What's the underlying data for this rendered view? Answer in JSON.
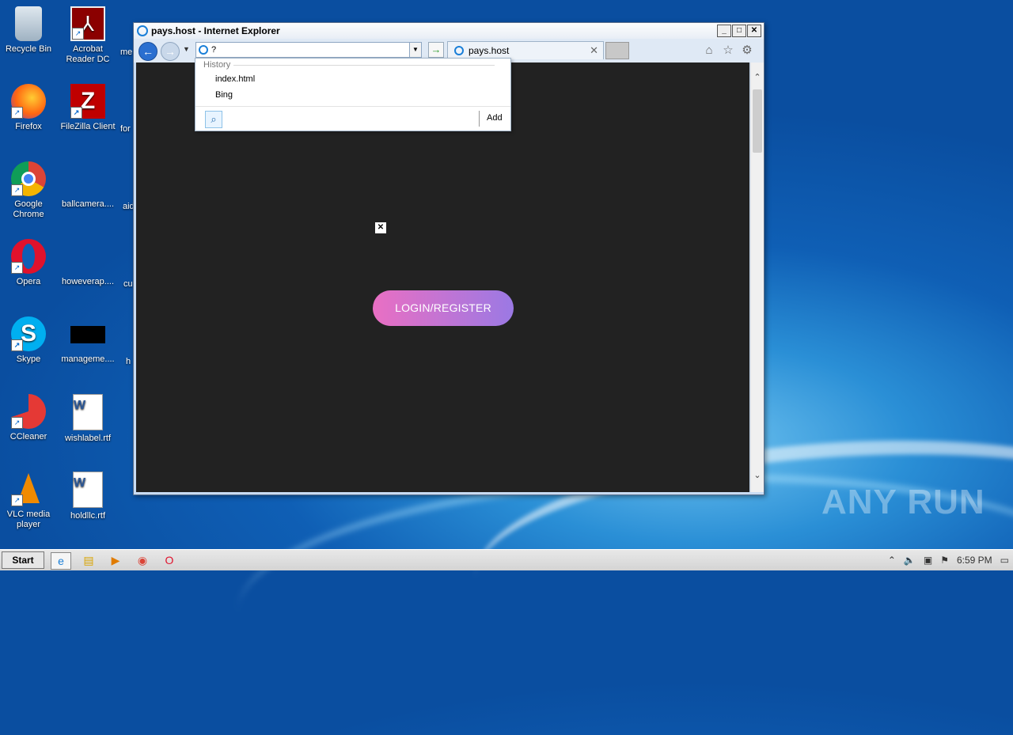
{
  "desktop": {
    "icons": [
      {
        "label": "Recycle Bin",
        "icon": "recycle-bin-icon"
      },
      {
        "label": "Acrobat Reader DC",
        "icon": "acrobat-icon"
      },
      {
        "label": "Firefox",
        "icon": "firefox-icon"
      },
      {
        "label": "FileZilla Client",
        "icon": "filezilla-icon"
      },
      {
        "label": "Google Chrome",
        "icon": "chrome-icon"
      },
      {
        "label": "ballcamera....",
        "icon": "blank-file-icon"
      },
      {
        "label": "Opera",
        "icon": "opera-icon"
      },
      {
        "label": "howeverap....",
        "icon": "blank-file-icon"
      },
      {
        "label": "Skype",
        "icon": "skype-icon"
      },
      {
        "label": "manageme....",
        "icon": "black-file-icon"
      },
      {
        "label": "CCleaner",
        "icon": "ccleaner-icon"
      },
      {
        "label": "wishlabel.rtf",
        "icon": "word-document-icon"
      },
      {
        "label": "VLC media player",
        "icon": "vlc-icon"
      },
      {
        "label": "holdllc.rtf",
        "icon": "word-document-icon"
      }
    ],
    "partial_labels": [
      "me",
      "for",
      "aid",
      "cu",
      "h"
    ]
  },
  "window": {
    "title": "pays.host - Internet Explorer",
    "address_value": "?",
    "tab_label": "pays.host",
    "minimize": "_",
    "maximize": "□",
    "close": "✕"
  },
  "dropdown": {
    "section_label": "History",
    "items": [
      "index.html",
      "Bing"
    ],
    "add_label": "Add"
  },
  "page": {
    "button_label": "LOGIN/REGISTER",
    "broken_image_glyph": "✕"
  },
  "taskbar": {
    "start_label": "Start",
    "clock": "6:59 PM"
  },
  "watermark": "ANY  RUN",
  "colors": {
    "page_bg": "#222222",
    "button_gradient_start": "#e96fc3",
    "button_gradient_end": "#9b79e4"
  }
}
